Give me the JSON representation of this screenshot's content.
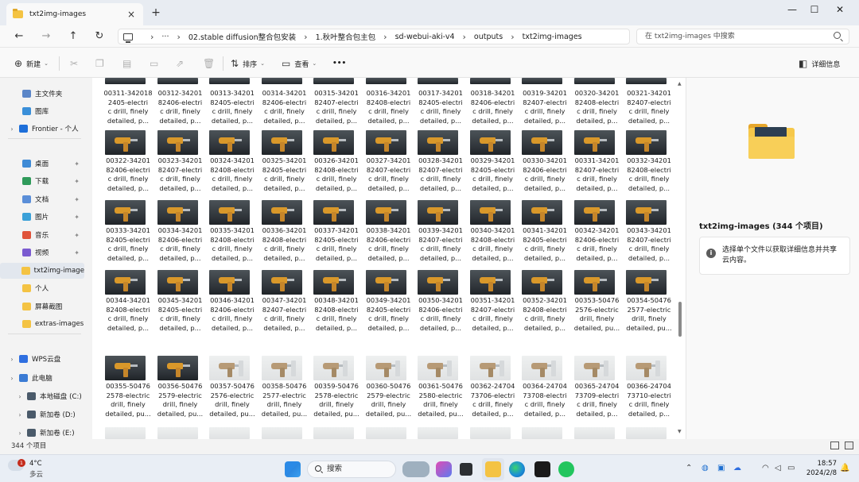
{
  "tab": {
    "title": "txt2img-images",
    "close": "×",
    "new": "+"
  },
  "window": {
    "min": "—",
    "max": "☐",
    "close": "✕"
  },
  "nav": {
    "back": "←",
    "forward": "→",
    "up": "↑",
    "refresh": "↻"
  },
  "breadcrumb": [
    "···",
    "02.stable diffusion整合包安装",
    "1.秋叶整合包主包",
    "sd-webui-aki-v4",
    "outputs",
    "txt2img-images"
  ],
  "search": {
    "placeholder": "在 txt2img-images 中搜索"
  },
  "toolbar": {
    "new": "新建",
    "sort": "排序",
    "view": "查看",
    "more": "•••",
    "details": "详细信息"
  },
  "sidebar": [
    {
      "label": "主文件夹",
      "icon": "home-icon",
      "color": "#5b86c8"
    },
    {
      "label": "图库",
      "icon": "gallery-icon",
      "color": "#3a8fd9"
    },
    {
      "label": "Frontier - 个人",
      "icon": "cloud-icon",
      "color": "#1e6fd9",
      "chev": true
    },
    {
      "label": "桌面",
      "icon": "desktop-icon",
      "color": "#3f8bd6",
      "pin": true
    },
    {
      "label": "下载",
      "icon": "download-icon",
      "color": "#2f9a5a",
      "pin": true
    },
    {
      "label": "文档",
      "icon": "document-icon",
      "color": "#5a8ed8",
      "pin": true
    },
    {
      "label": "图片",
      "icon": "pictures-icon",
      "color": "#3aa0d8",
      "pin": true
    },
    {
      "label": "音乐",
      "icon": "music-icon",
      "color": "#e0533a",
      "pin": true
    },
    {
      "label": "视频",
      "icon": "video-icon",
      "color": "#7b5bd0",
      "pin": true
    },
    {
      "label": "txt2img-image",
      "icon": "folder-icon",
      "color": "#f4c343",
      "selected": true
    },
    {
      "label": "个人",
      "icon": "folder-icon",
      "color": "#f4c343"
    },
    {
      "label": "屏幕截图",
      "icon": "folder-icon",
      "color": "#f4c343"
    },
    {
      "label": "extras-images",
      "icon": "folder-icon",
      "color": "#f4c343"
    },
    {
      "label": "WPS云盘",
      "icon": "cloud-icon",
      "color": "#2f6fe0",
      "chev": true
    },
    {
      "label": "此电脑",
      "icon": "pc-icon",
      "color": "#3b7bd4",
      "chev": true
    },
    {
      "label": "本地磁盘 (C:)",
      "icon": "drive-icon",
      "color": "#4a5a6a",
      "chev": true
    },
    {
      "label": "新加卷 (D:)",
      "icon": "drive-icon",
      "color": "#4a5a6a",
      "chev": true
    },
    {
      "label": "新加卷 (E:)",
      "icon": "drive-icon",
      "color": "#4a5a6a",
      "chev": true
    }
  ],
  "files": [
    {
      "name": "00311-342018\n2405-electri\nc drill, finely\ndetailed, p...",
      "tone": "dark"
    },
    {
      "name": "00312-34201\n82406-electri\nc drill, finely\ndetailed, p...",
      "tone": "dark"
    },
    {
      "name": "00313-34201\n82405-electri\nc drill, finely\ndetailed, p...",
      "tone": "dark"
    },
    {
      "name": "00314-34201\n82406-electri\nc drill, finely\ndetailed, p...",
      "tone": "dark"
    },
    {
      "name": "00315-34201\n82407-electri\nc drill, finely\ndetailed, p...",
      "tone": "dark"
    },
    {
      "name": "00316-34201\n82408-electri\nc drill, finely\ndetailed, p...",
      "tone": "dark"
    },
    {
      "name": "00317-34201\n82405-electri\nc drill, finely\ndetailed, p...",
      "tone": "dark"
    },
    {
      "name": "00318-34201\n82406-electri\nc drill, finely\ndetailed, p...",
      "tone": "dark"
    },
    {
      "name": "00319-34201\n82407-electri\nc drill, finely\ndetailed, p...",
      "tone": "dark"
    },
    {
      "name": "00320-34201\n82408-electri\nc drill, finely\ndetailed, p...",
      "tone": "dark"
    },
    {
      "name": "00321-34201\n82407-electri\nc drill, finely\ndetailed, p...",
      "tone": "dark"
    },
    {
      "name": "00322-34201\n82406-electri\nc drill, finely\ndetailed, p...",
      "tone": "dark"
    },
    {
      "name": "00323-34201\n82407-electri\nc drill, finely\ndetailed, p...",
      "tone": "dark"
    },
    {
      "name": "00324-34201\n82408-electri\nc drill, finely\ndetailed, p...",
      "tone": "dark"
    },
    {
      "name": "00325-34201\n82405-electri\nc drill, finely\ndetailed, p...",
      "tone": "dark"
    },
    {
      "name": "00326-34201\n82408-electri\nc drill, finely\ndetailed, p...",
      "tone": "dark"
    },
    {
      "name": "00327-34201\n82407-electri\nc drill, finely\ndetailed, p...",
      "tone": "dark"
    },
    {
      "name": "00328-34201\n82407-electri\nc drill, finely\ndetailed, p...",
      "tone": "dark"
    },
    {
      "name": "00329-34201\n82405-electri\nc drill, finely\ndetailed, p...",
      "tone": "dark"
    },
    {
      "name": "00330-34201\n82406-electri\nc drill, finely\ndetailed, p...",
      "tone": "dark"
    },
    {
      "name": "00331-34201\n82407-electri\nc drill, finely\ndetailed, p...",
      "tone": "dark"
    },
    {
      "name": "00332-34201\n82408-electri\nc drill, finely\ndetailed, p...",
      "tone": "dark"
    },
    {
      "name": "00333-34201\n82405-electri\nc drill, finely\ndetailed, p...",
      "tone": "dark"
    },
    {
      "name": "00334-34201\n82406-electri\nc drill, finely\ndetailed, p...",
      "tone": "dark"
    },
    {
      "name": "00335-34201\n82408-electri\nc drill, finely\ndetailed, p...",
      "tone": "dark"
    },
    {
      "name": "00336-34201\n82408-electri\nc drill, finely\ndetailed, p...",
      "tone": "dark"
    },
    {
      "name": "00337-34201\n82405-electri\nc drill, finely\ndetailed, p...",
      "tone": "dark"
    },
    {
      "name": "00338-34201\n82406-electri\nc drill, finely\ndetailed, p...",
      "tone": "dark"
    },
    {
      "name": "00339-34201\n82407-electri\nc drill, finely\ndetailed, p...",
      "tone": "dark"
    },
    {
      "name": "00340-34201\n82408-electri\nc drill, finely\ndetailed, p...",
      "tone": "dark"
    },
    {
      "name": "00341-34201\n82405-electri\nc drill, finely\ndetailed, p...",
      "tone": "dark"
    },
    {
      "name": "00342-34201\n82406-electri\nc drill, finely\ndetailed, p...",
      "tone": "dark"
    },
    {
      "name": "00343-34201\n82407-electri\nc drill, finely\ndetailed, p...",
      "tone": "dark"
    },
    {
      "name": "00344-34201\n82408-electri\nc drill, finely\ndetailed, p...",
      "tone": "dark"
    },
    {
      "name": "00345-34201\n82405-electri\nc drill, finely\ndetailed, p...",
      "tone": "dark"
    },
    {
      "name": "00346-34201\n82406-electri\nc drill, finely\ndetailed, p...",
      "tone": "dark"
    },
    {
      "name": "00347-34201\n82407-electri\nc drill, finely\ndetailed, p...",
      "tone": "dark"
    },
    {
      "name": "00348-34201\n82408-electri\nc drill, finely\ndetailed, p...",
      "tone": "dark"
    },
    {
      "name": "00349-34201\n82405-electri\nc drill, finely\ndetailed, p...",
      "tone": "dark"
    },
    {
      "name": "00350-34201\n82406-electri\nc drill, finely\ndetailed, p...",
      "tone": "dark"
    },
    {
      "name": "00351-34201\n82407-electri\nc drill, finely\ndetailed, p...",
      "tone": "dark"
    },
    {
      "name": "00352-34201\n82408-electri\nc drill, finely\ndetailed, p...",
      "tone": "dark"
    },
    {
      "name": "00353-50476\n2576-electric\ndrill, finely\ndetailed, pu...",
      "tone": "dark"
    },
    {
      "name": "00354-50476\n2577-electric\ndrill, finely\ndetailed, pu...",
      "tone": "dark"
    },
    {
      "name": "00355-50476\n2578-electric\ndrill, finely\ndetailed, pu...",
      "tone": "dark"
    },
    {
      "name": "00356-50476\n2579-electric\ndrill, finely\ndetailed, pu...",
      "tone": "dark"
    },
    {
      "name": "00357-50476\n2576-electric\ndrill, finely\ndetailed, pu...",
      "tone": "light"
    },
    {
      "name": "00358-50476\n2577-electric\ndrill, finely\ndetailed, pu...",
      "tone": "light"
    },
    {
      "name": "00359-50476\n2578-electric\ndrill, finely\ndetailed, pu...",
      "tone": "light"
    },
    {
      "name": "00360-50476\n2579-electric\ndrill, finely\ndetailed, pu...",
      "tone": "light"
    },
    {
      "name": "00361-50476\n2580-electric\ndrill, finely\ndetailed, pu...",
      "tone": "light"
    },
    {
      "name": "00362-24704\n73706-electri\nc drill, finely\ndetailed, p...",
      "tone": "light"
    },
    {
      "name": "00364-24704\n73708-electri\nc drill, finely\ndetailed, p...",
      "tone": "light"
    },
    {
      "name": "00365-24704\n73709-electri\nc drill, finely\ndetailed, p...",
      "tone": "light"
    },
    {
      "name": "00366-24704\n73710-electri\nc drill, finely\ndetailed, p...",
      "tone": "light"
    }
  ],
  "details": {
    "title": "txt2img-images (344 个项目)",
    "hint": "选择单个文件以获取详细信息并共享云内容。",
    "info": "i"
  },
  "status": {
    "count": "344 个项目"
  },
  "taskbar": {
    "weather_temp": "4°C",
    "weather_desc": "多云",
    "badge": "1",
    "search": "搜索",
    "time": "18:57",
    "date": "2024/2/8"
  }
}
